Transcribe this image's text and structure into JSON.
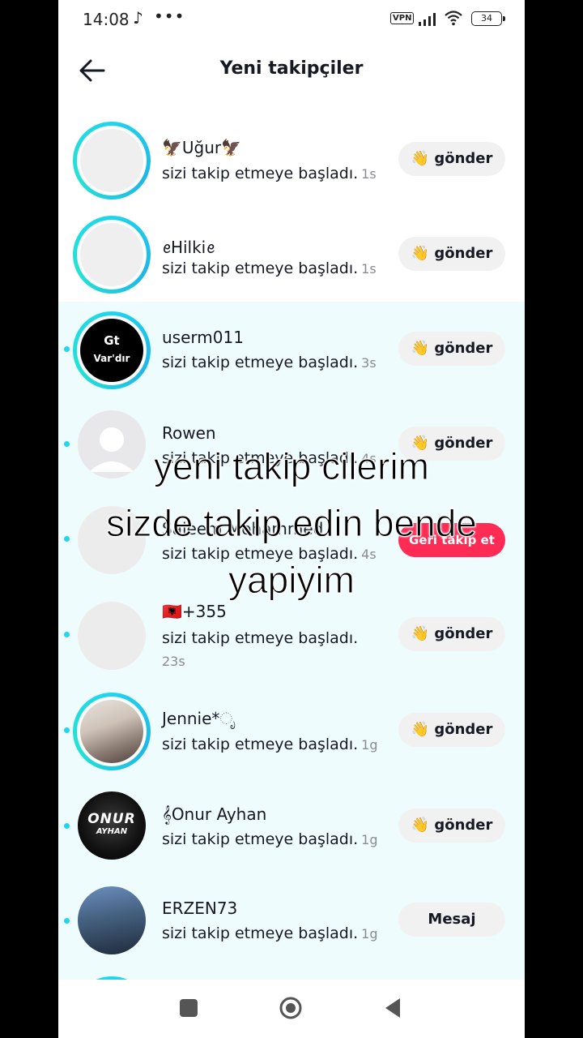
{
  "status_bar": {
    "time": "14:08",
    "dots": "•••",
    "vpn": "VPN",
    "battery": "34"
  },
  "header": {
    "title": "Yeni takipçiler"
  },
  "followers": [
    {
      "name": "🦅Uğur🦅",
      "text": "sizi takip etmeye başladı.",
      "time": "1s",
      "button": "👋 gönder",
      "ring": true,
      "unread": false
    },
    {
      "name": "ꫀHilkiꫀ",
      "text": "sizi takip etmeye başladı.",
      "time": "1s",
      "button": "👋 gönder",
      "ring": true,
      "unread": false
    },
    {
      "name": "userm011",
      "text": "sizi takip etmeye başladı.",
      "time": "3s",
      "button": "👋 gönder",
      "ring": true,
      "unread": true,
      "avatar_text": [
        "Gt",
        "Var'dır"
      ]
    },
    {
      "name": "Rowen",
      "text": "sizi takip etmeye başladı.",
      "time": "4s",
      "button": "👋 gönder",
      "ring": false,
      "unread": true
    },
    {
      "name": "Saleem Mohammed",
      "text": "sizi takip etmeye başladı.",
      "time": "4s",
      "button": "Geri takip et",
      "ring": false,
      "unread": true
    },
    {
      "name": "🇦🇱+355",
      "text": "sizi takip etmeye başladı.",
      "time": "23s",
      "button": "👋 gönder",
      "ring": false,
      "unread": true
    },
    {
      "name": "Jennie*ೃ",
      "text": "sizi takip etmeye başladı.",
      "time": "1g",
      "button": "👋 gönder",
      "ring": true,
      "unread": true
    },
    {
      "name": "𝄞Onur Ayhan",
      "text": "sizi takip etmeye başladı.",
      "time": "1g",
      "button": "👋 gönder",
      "ring": false,
      "unread": true,
      "avatar_text": [
        "ONUR",
        "AYHAN"
      ]
    },
    {
      "name": "ERZEN73",
      "text": "sizi takip etmeye başladı.",
      "time": "1g",
      "button": "Mesaj",
      "ring": false,
      "unread": true
    }
  ],
  "overlay_caption": {
    "line1": "yeni takip cilerim",
    "line2": "sizde takip edin bende",
    "line3": "yapiyim"
  },
  "colors": {
    "accent": "#20d5ec",
    "follow_back": "#fe2c55",
    "new_bg": "#effcfd"
  }
}
